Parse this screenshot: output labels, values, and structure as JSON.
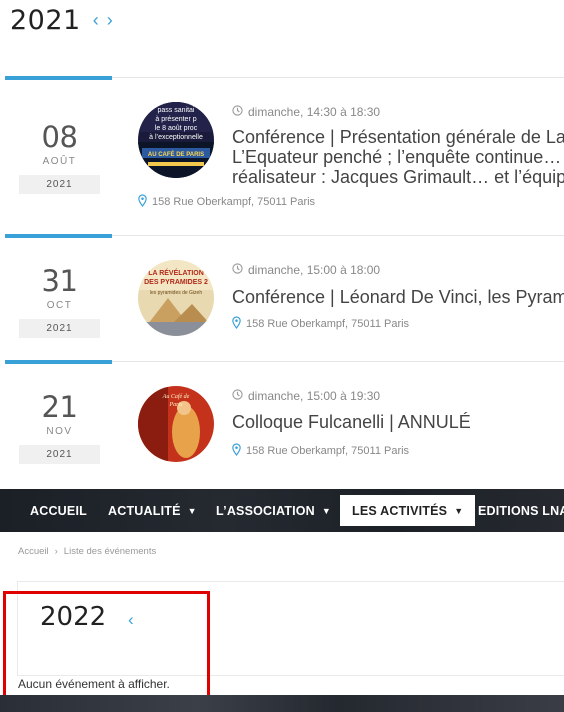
{
  "year_nav": {
    "year": "2021",
    "prev_icon": "‹",
    "next_icon": "›"
  },
  "events": [
    {
      "day": "08",
      "month": "AOÛT",
      "year": "2021",
      "time": "dimanche, 14:30 à 18:30",
      "title_lines": [
        "Conférence | Présentation générale de La",
        "L’Equateur penché ; l’enquête continue… p",
        "réalisateur : Jacques Grimault… et l’équipe"
      ],
      "address": "158 Rue Oberkampf, 75011 Paris",
      "thumb_text": [
        "pass sanitai",
        "à présenter p",
        "le 8 août proc",
        "à l’exceptionnelle",
        "AU CAFÉ DE PARIS"
      ]
    },
    {
      "day": "31",
      "month": "OCT",
      "year": "2021",
      "time": "dimanche, 15:00 à 18:00",
      "title_lines": [
        "Conférence | Léonard De Vinci, les Pyrami"
      ],
      "address": "158 Rue Oberkampf, 75011 Paris",
      "thumb_text": [
        "LA RÉVÉLATION",
        "DES PYRAMIDES 2",
        "les pyramides de Gizeh"
      ]
    },
    {
      "day": "21",
      "month": "NOV",
      "year": "2021",
      "time": "dimanche, 15:00 à 19:30",
      "title_lines": [
        "Colloque Fulcanelli | ANNULÉ"
      ],
      "address": "158 Rue Oberkampf, 75011 Paris",
      "thumb_text": [
        "Au Café de",
        "Paris"
      ]
    }
  ],
  "nav": {
    "items": [
      {
        "label": "ACCUEIL"
      },
      {
        "label": "ACTUALITÉ"
      },
      {
        "label": "L’ASSOCIATION"
      },
      {
        "label": "LES ACTIVITÉS"
      },
      {
        "label": "EDITIONS LNA"
      }
    ]
  },
  "breadcrumb": {
    "home": "Accueil",
    "sep": "›",
    "current": "Liste des événements"
  },
  "year2": {
    "year": "2022",
    "prev_icon": "‹"
  },
  "no_events": "Aucun événement à afficher.",
  "colors": {
    "accent": "#3aa0d8",
    "highlight": "#e00000",
    "nav_bg": "#1f232a"
  }
}
